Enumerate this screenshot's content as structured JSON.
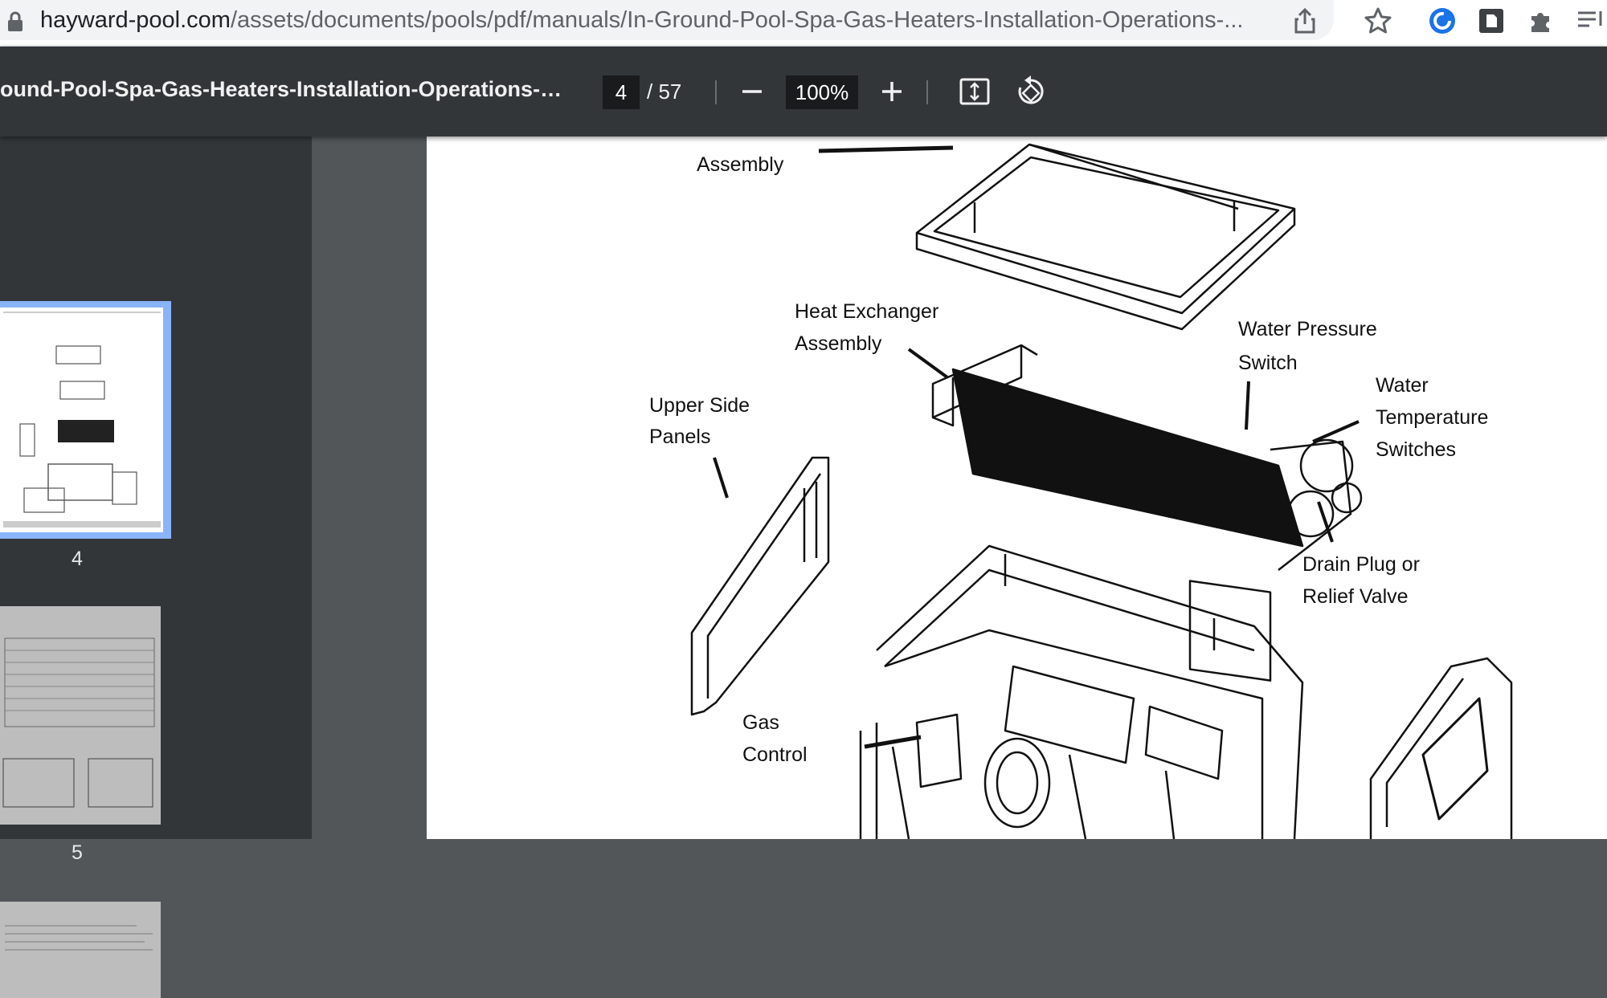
{
  "browser": {
    "url_host": "hayward-pool.com",
    "url_path": "/assets/documents/pools/pdf/manuals/In-Ground-Pool-Spa-Gas-Heaters-Installation-Operations-...",
    "icons": [
      "lock-icon",
      "share-icon",
      "star-icon",
      "extension-c-icon",
      "extension-doc-icon",
      "puzzle-icon",
      "reading-list-icon"
    ]
  },
  "toolbar": {
    "title": "ound-Pool-Spa-Gas-Heaters-Installation-Operations-Man...",
    "page_current": "4",
    "page_total": "/ 57",
    "zoom": "100%",
    "icons": [
      "zoom-out-icon",
      "zoom-in-icon",
      "fit-page-icon",
      "rotate-icon"
    ]
  },
  "sidebar": {
    "thumbnails": [
      {
        "page": "4",
        "selected": true
      },
      {
        "page": "5",
        "selected": false
      },
      {
        "page": "",
        "selected": false
      }
    ]
  },
  "diagram": {
    "labels": {
      "rain_shield_line2": "Assembly",
      "heat_exchanger_1": "Heat Exchanger",
      "heat_exchanger_2": "Assembly",
      "water_pressure_1": "Water Pressure",
      "water_pressure_2": "Switch",
      "water_temp_1": "Water",
      "water_temp_2": "Temperature",
      "water_temp_3": "Switches",
      "upper_side_1": "Upper Side",
      "upper_side_2": "Panels",
      "drain_plug_1": "Drain Plug or",
      "drain_plug_2": "Relief Valve",
      "gas_control_1": "Gas",
      "gas_control_2": "Control"
    }
  }
}
